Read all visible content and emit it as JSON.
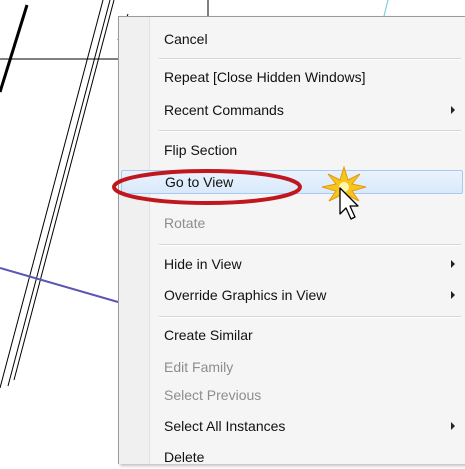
{
  "context_menu": {
    "items": [
      {
        "label": "Cancel",
        "enabled": true,
        "submenu": false
      },
      {
        "label": "Repeat [Close Hidden Windows]",
        "enabled": true,
        "submenu": false
      },
      {
        "label": "Recent Commands",
        "enabled": true,
        "submenu": true
      },
      {
        "label": "Flip Section",
        "enabled": true,
        "submenu": false
      },
      {
        "label": "Go to View",
        "enabled": true,
        "submenu": false,
        "highlighted": true
      },
      {
        "label": "Rotate",
        "enabled": false,
        "submenu": false
      },
      {
        "label": "Hide in View",
        "enabled": true,
        "submenu": true
      },
      {
        "label": "Override Graphics in View",
        "enabled": true,
        "submenu": true
      },
      {
        "label": "Create Similar",
        "enabled": true,
        "submenu": false
      },
      {
        "label": "Edit Family",
        "enabled": false,
        "submenu": false
      },
      {
        "label": "Select Previous",
        "enabled": false,
        "submenu": false
      },
      {
        "label": "Select All Instances",
        "enabled": true,
        "submenu": true
      },
      {
        "label": "Delete",
        "enabled": true,
        "submenu": false
      }
    ]
  },
  "colors": {
    "highlight_ellipse": "#c0171f",
    "disabled_text": "#8d8d8d",
    "section_line": "#5b55b5",
    "cursor_burst": "#f7c51c"
  },
  "icons": {
    "submenu": "chevron-right-icon",
    "cursor": "mouse-pointer-icon",
    "burst": "click-burst-icon"
  }
}
